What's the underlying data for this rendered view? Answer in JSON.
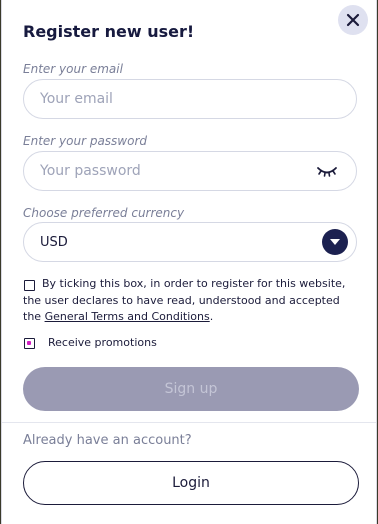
{
  "modal": {
    "title": "Register new user!",
    "close_icon": "close-icon"
  },
  "email": {
    "label": "Enter your email",
    "placeholder": "Your email",
    "value": ""
  },
  "password": {
    "label": "Enter your password",
    "placeholder": "Your password",
    "value": "",
    "toggle_icon": "eye-closed-icon"
  },
  "currency": {
    "label": "Choose preferred currency",
    "selected": "USD",
    "chevron_icon": "chevron-down-icon"
  },
  "terms": {
    "checked": false,
    "text_before": "By ticking this box, in order to register for this website, the user declares to have read, understood and accepted the ",
    "link_text": "General Terms and Conditions",
    "text_after": "."
  },
  "promotions": {
    "checked": true,
    "label": "Receive promotions"
  },
  "signup_button": {
    "label": "Sign up"
  },
  "login_section": {
    "prompt": "Already have an account?",
    "button_label": "Login"
  },
  "colors": {
    "navy": "#1c2150",
    "disabled_button": "#9a9ab3",
    "checkbox_accent": "#d21dc4",
    "close_bg": "#dfe1f0"
  }
}
